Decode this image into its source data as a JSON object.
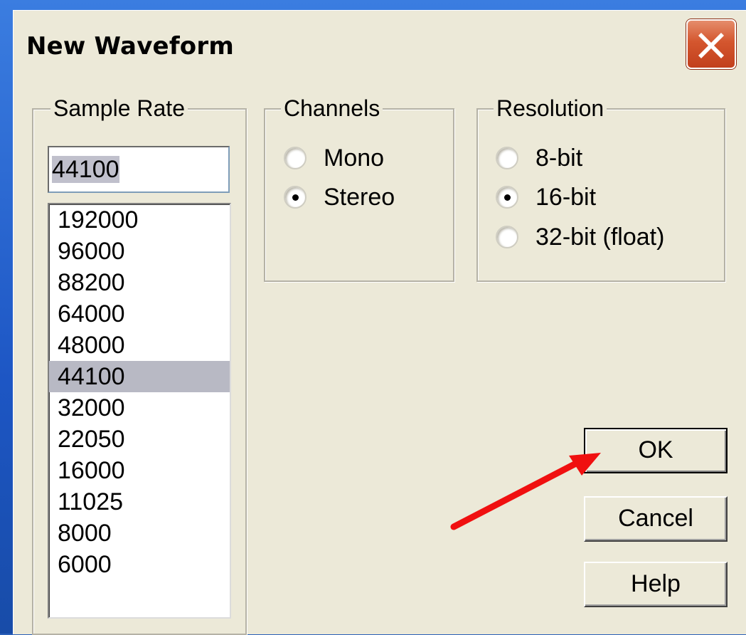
{
  "dialog": {
    "title": "New Waveform",
    "close_icon": "close-icon"
  },
  "sample_rate": {
    "legend": "Sample Rate",
    "input_value": "44100",
    "options": [
      "192000",
      "96000",
      "88200",
      "64000",
      "48000",
      "44100",
      "32000",
      "22050",
      "16000",
      "11025",
      "8000",
      "6000"
    ],
    "selected": "44100"
  },
  "channels": {
    "legend": "Channels",
    "options": [
      {
        "label": "Mono",
        "checked": false
      },
      {
        "label": "Stereo",
        "checked": true
      }
    ]
  },
  "resolution": {
    "legend": "Resolution",
    "options": [
      {
        "label": "8-bit",
        "checked": false
      },
      {
        "label": "16-bit",
        "checked": true
      },
      {
        "label": "32-bit (float)",
        "checked": false
      }
    ]
  },
  "buttons": {
    "ok": "OK",
    "cancel": "Cancel",
    "help": "Help"
  },
  "annotation": {
    "arrow_color": "#ff0000",
    "arrow_icon": "red-arrow-pointer"
  }
}
